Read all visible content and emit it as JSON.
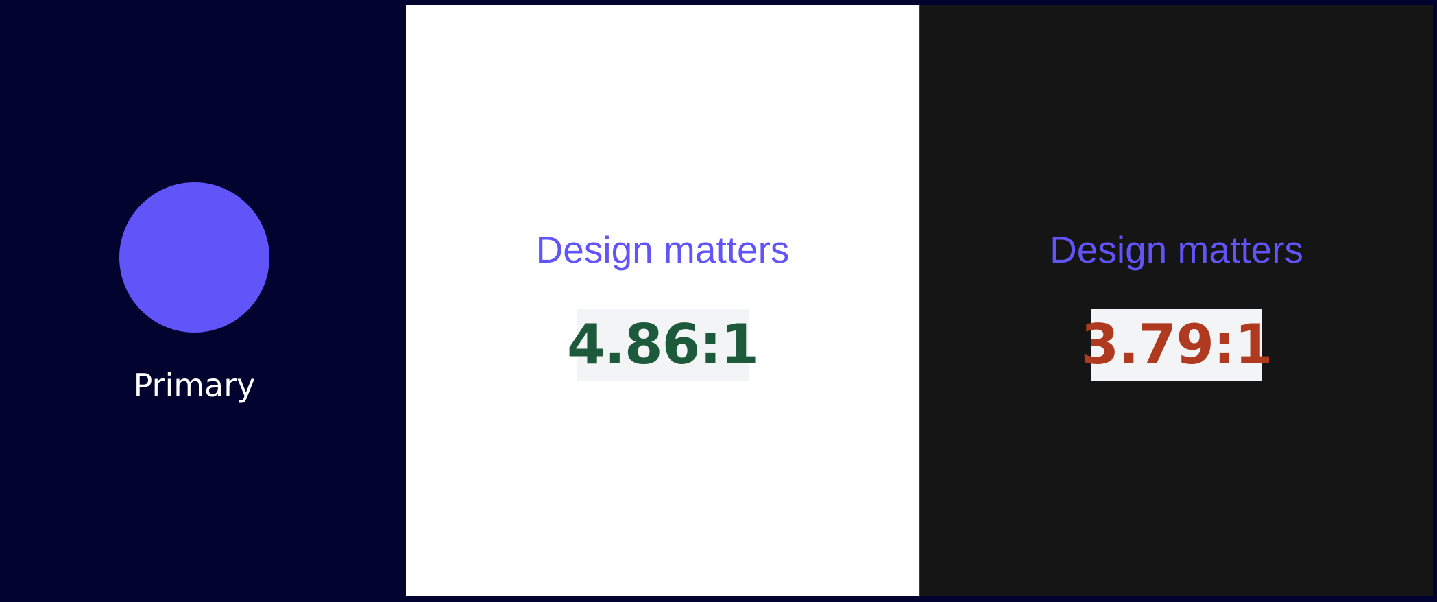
{
  "swatch": {
    "name": "Primary",
    "color": "#6154f8"
  },
  "previews": {
    "light": {
      "background": "#ffffff",
      "sample_text": "Design matters",
      "contrast_ratio": "4.86:1",
      "ratio_color": "#1d5a3c"
    },
    "dark": {
      "background": "#151515",
      "sample_text": "Design matters",
      "contrast_ratio": "3.79:1",
      "ratio_color": "#b03a20"
    }
  }
}
